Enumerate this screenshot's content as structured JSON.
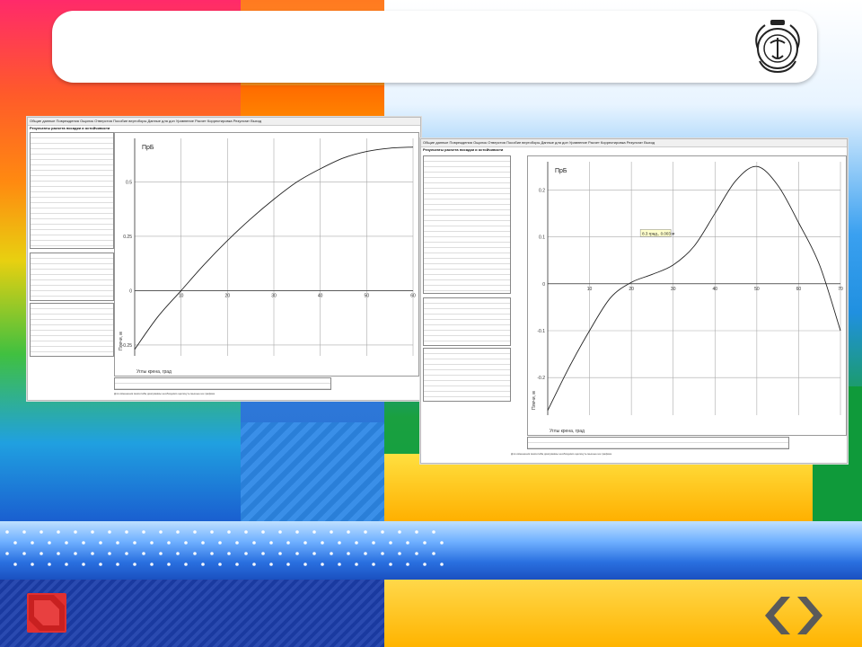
{
  "slide": {
    "title": ""
  },
  "window1": {
    "menu": [
      "Общие данные",
      "Повреждения",
      "Ощилок",
      "Отверстия",
      "Пособие вертоборы",
      "Данные для дон",
      "Уравнение",
      "Расчет",
      "Корректировка",
      "Результат",
      "Выход"
    ],
    "heading": "Результаты расчета посадки и остойчивости",
    "chart": {
      "label": "ПрБ",
      "xlabel": "Углы крена, град",
      "ylabel": "Плечи, м"
    },
    "note": "Для изменения масштаба диаграммы необходимо щелкнуть мышью на графике"
  },
  "window2": {
    "menu": [
      "Общие данные",
      "Повреждения",
      "Ощилок",
      "Отверстия",
      "Пособие вертоборы",
      "Данные для дон",
      "Уравнение",
      "Расчет",
      "Корректировка",
      "Результат",
      "Выход"
    ],
    "heading": "Результаты расчета посадки и остойчивости",
    "chart": {
      "label": "ПрБ",
      "xlabel": "Углы крена, град",
      "ylabel": "Плечи, м",
      "annotation": "8.3 град., 0.003 м"
    },
    "note": "Для изменения масштаба диаграммы необходимо щелкнуть мышью на графике"
  },
  "chart_data": [
    {
      "type": "line",
      "title": "",
      "x": [
        0,
        5,
        10,
        15,
        20,
        25,
        30,
        35,
        40,
        45,
        50,
        55,
        60
      ],
      "series": [
        {
          "name": "",
          "values": [
            -0.27,
            -0.12,
            0.0,
            0.12,
            0.23,
            0.33,
            0.42,
            0.5,
            0.56,
            0.61,
            0.64,
            0.655,
            0.66
          ]
        }
      ],
      "xticks": [
        10,
        20,
        30,
        40,
        50,
        60
      ],
      "yticks": [
        -0.25,
        0,
        0.25,
        0.5
      ],
      "xlim": [
        0,
        60
      ],
      "ylim": [
        -0.3,
        0.7
      ],
      "grid": true
    },
    {
      "type": "line",
      "title": "",
      "x": [
        0,
        5,
        10,
        15,
        20,
        25,
        30,
        35,
        40,
        45,
        50,
        55,
        60,
        65,
        70
      ],
      "series": [
        {
          "name": "",
          "values": [
            -0.27,
            -0.18,
            -0.1,
            -0.03,
            0.003,
            0.02,
            0.04,
            0.08,
            0.15,
            0.22,
            0.25,
            0.21,
            0.13,
            0.04,
            -0.1
          ]
        }
      ],
      "xticks": [
        10,
        20,
        30,
        40,
        50,
        60,
        70
      ],
      "yticks": [
        -0.2,
        -0.1,
        0,
        0.1,
        0.2
      ],
      "xlim": [
        0,
        70
      ],
      "ylim": [
        -0.28,
        0.26
      ],
      "grid": true
    }
  ],
  "colors": {
    "accent": "#2a6fd0",
    "nav_left": "#e03030",
    "band": "#2a70e0"
  }
}
